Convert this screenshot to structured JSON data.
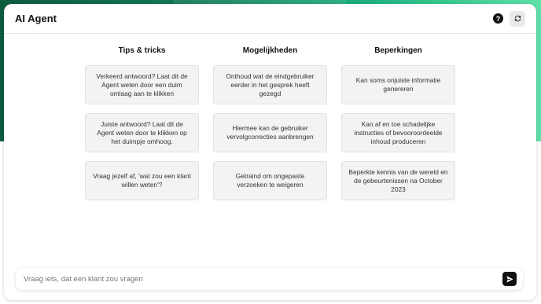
{
  "app": {
    "title": "AI Agent"
  },
  "header": {
    "help_icon": "question-circle-icon",
    "refresh_icon": "refresh-icon"
  },
  "columns": [
    {
      "title": "Tips & tricks",
      "cards": [
        "Verkeerd antwoord? Laat dit de Agent weten door een duim omlaag aan te klikken",
        "Juiste antwoord? Laat dit de Agent weten door te klikken op het duimpje omhoog.",
        "Vraag jezelf af, 'wat zou een klant willen weten'?"
      ]
    },
    {
      "title": "Mogelijkheden",
      "cards": [
        "Onthoud wat de eindgebruiker eerder in het gesprek heeft gezegd",
        "Hiermee kan de gebruiker vervolgcorrecties aanbrengen",
        "Getraind om ongepaste verzoeken te weigeren"
      ]
    },
    {
      "title": "Beperkingen",
      "cards": [
        "Kan soms onjuiste informatie genereren",
        "Kan af en toe schadelijke instructies of bevooroordeelde inhoud produceren",
        "Beperkte kennis van de wereld en de gebeurtenissen na October 2023"
      ]
    }
  ],
  "input": {
    "placeholder": "Vraag iets, dat een klant zou vragen",
    "value": ""
  },
  "send": {
    "icon": "send-arrow-icon"
  },
  "colors": {
    "brand_dark": "#0f5b3f",
    "brand_light": "#5fe0a8",
    "card_bg": "#f2f3f3"
  }
}
